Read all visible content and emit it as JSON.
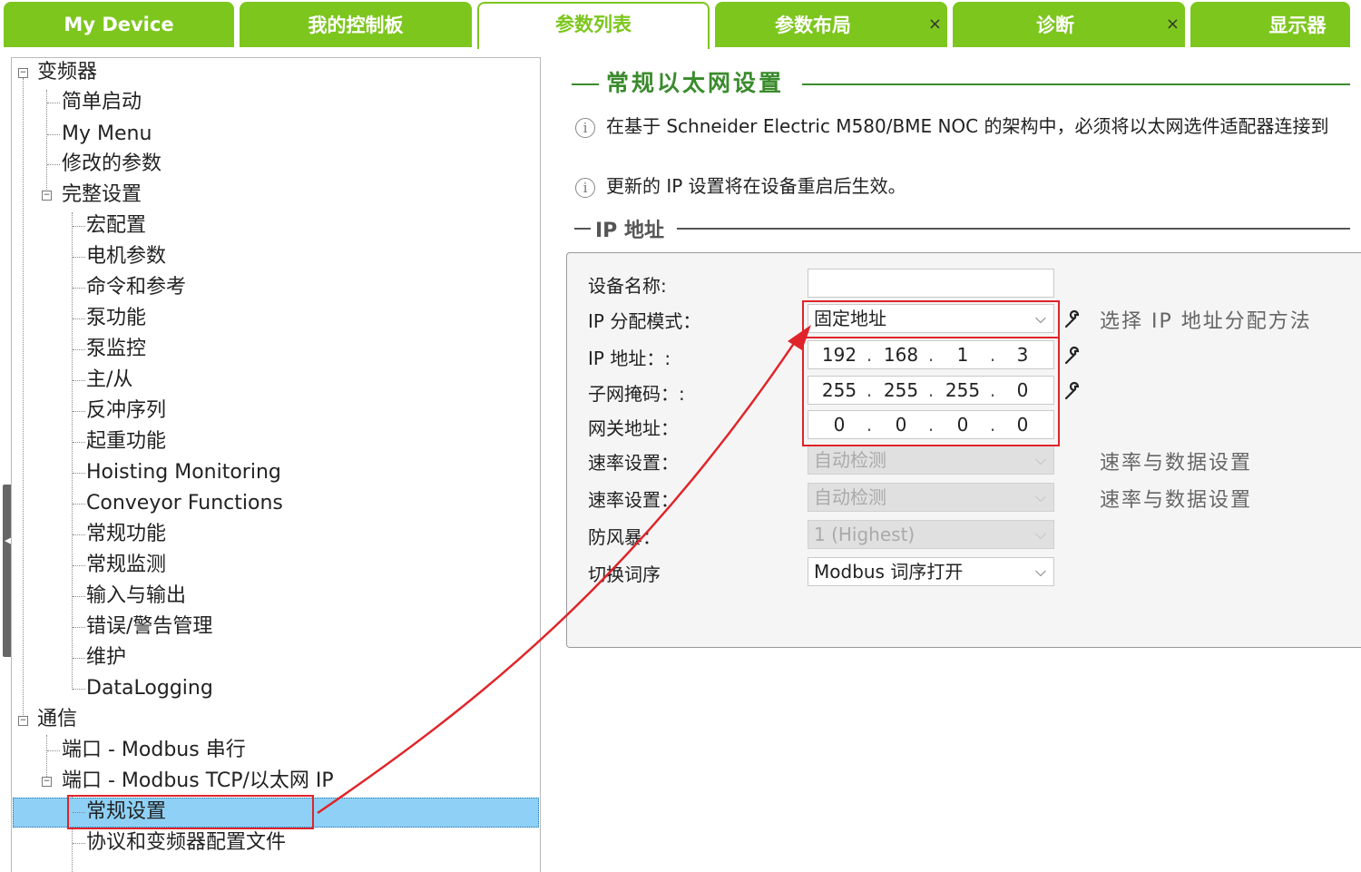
{
  "tabs": [
    {
      "label": "My Device"
    },
    {
      "label": "我的控制板"
    },
    {
      "label": "参数列表"
    },
    {
      "label": "参数布局",
      "close": "×"
    },
    {
      "label": "诊断",
      "close": "×"
    },
    {
      "label": "显示器"
    }
  ],
  "tree": {
    "root": "变频器",
    "simple_start": "简单启动",
    "my_menu": "My Menu",
    "modified": "修改的参数",
    "complete": "完整设置",
    "macro": "宏配置",
    "motor": "电机参数",
    "command": "命令和参考",
    "pump_func": "泵功能",
    "pump_mon": "泵监控",
    "master_slave": "主/从",
    "backlash": "反冲序列",
    "hoisting": "起重功能",
    "hoisting_mon": "Hoisting Monitoring",
    "conveyor": "Conveyor Functions",
    "generic_func": "常规功能",
    "generic_mon": "常规监测",
    "io": "输入与输出",
    "error": "错误/警告管理",
    "maintenance": "维护",
    "datalogging": "DataLogging",
    "comm": "通信",
    "port_serial": "端口 - Modbus 串行",
    "port_tcp": "端口 - Modbus TCP/以太网 IP",
    "general_settings": "常规设置",
    "protocol_config": "协议和变频器配置文件"
  },
  "panel": {
    "title": "常规以太网设置",
    "info1": "在基于 Schneider Electric M580/BME NOC 的架构中，必须将以太网选件适配器连接到",
    "info2": "更新的 IP 设置将在设备重启后生效。",
    "ip_section": "IP 地址",
    "labels": {
      "device_name": "设备名称:",
      "ip_mode": "IP 分配模式：",
      "ip_address": "IP 地址：:",
      "subnet": "子网掩码：:",
      "gateway": "网关地址：",
      "rate1": "速率设置：",
      "rate2": "速率设置：",
      "storm": "防风暴：",
      "word_order": "切换词序"
    },
    "values": {
      "device_name": "",
      "ip_mode": "固定地址",
      "ip": [
        "192",
        "168",
        "1",
        "3"
      ],
      "subnet": [
        "255",
        "255",
        "255",
        "0"
      ],
      "gateway": [
        "0",
        "0",
        "0",
        "0"
      ],
      "rate1": "自动检测",
      "rate2": "自动检测",
      "storm": "1 (Highest)",
      "word_order": "Modbus 词序打开"
    },
    "hints": {
      "ip_mode": "选择 IP 地址分配方法",
      "rate1": "速率与数据设置",
      "rate2": "速率与数据设置"
    }
  },
  "colors": {
    "tab_green": "#7dc61e",
    "title_green": "#3a8b2c",
    "selection_blue": "#8fd1f6",
    "annotation_red": "#e0242a"
  }
}
